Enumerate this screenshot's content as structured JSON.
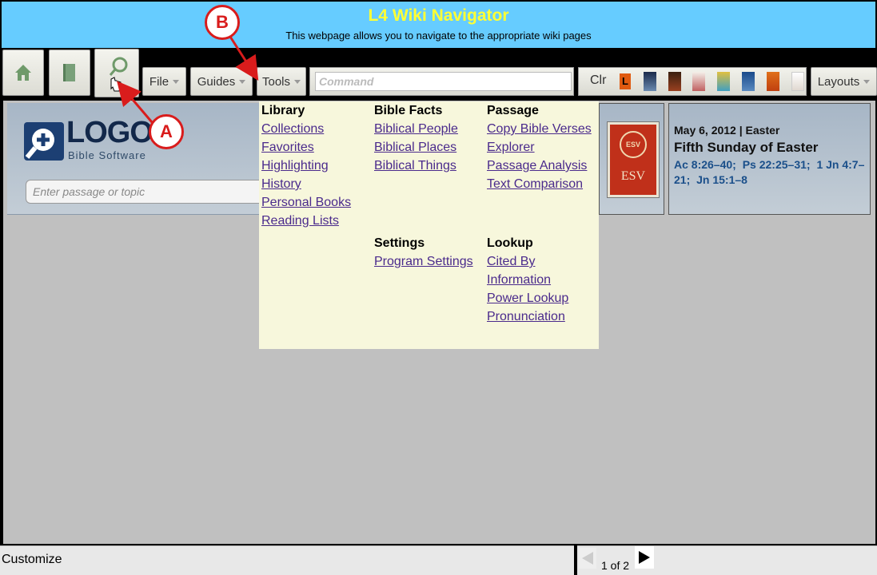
{
  "header": {
    "title": "L4 Wiki Navigator",
    "subtitle": "This webpage allows you to navigate to the appropriate wiki pages"
  },
  "toolbar": {
    "icons": [
      "home-icon",
      "library-book-icon",
      "search-icon"
    ],
    "menus": {
      "file": "File",
      "guides": "Guides",
      "tools": "Tools",
      "layouts": "Layouts"
    },
    "command_placeholder": "Command",
    "clr_label": "Clr",
    "resource_l_label": "L"
  },
  "home_panel": {
    "logo_text": "LOGOS",
    "logo_subtitle": "Bible Software",
    "passage_placeholder": "Enter passage or topic",
    "esv_label": "ESV",
    "esv_seal": "ESV",
    "lectionary": {
      "date": "May 6, 2012 | Easter",
      "title": "Fifth Sunday of Easter",
      "readings": [
        "Ac 8:26–40;",
        "Ps 22:25–31;",
        "1 Jn 4:7–21;",
        "Jn 15:1–8"
      ]
    }
  },
  "tools_menu": {
    "library": {
      "heading": "Library",
      "items": [
        "Collections",
        "Favorites",
        "Highlighting",
        "History",
        "Personal Books",
        "Reading Lists"
      ]
    },
    "bible_facts": {
      "heading": "Bible Facts",
      "items": [
        "Biblical People",
        "Biblical Places",
        "Biblical Things"
      ]
    },
    "passage": {
      "heading": "Passage",
      "items": [
        "Copy Bible Verses",
        "Explorer",
        "Passage Analysis",
        "Text Comparison"
      ]
    },
    "settings": {
      "heading": "Settings",
      "items": [
        "Program Settings"
      ]
    },
    "lookup": {
      "heading": "Lookup",
      "items": [
        "Cited By",
        "Information",
        "Power Lookup",
        "Pronunciation"
      ]
    }
  },
  "statusbar": {
    "customize": "Customize",
    "page_count": "1 of 2"
  },
  "callouts": {
    "a": "A",
    "b": "B"
  },
  "colors": {
    "header_bg": "#66ccff",
    "header_title": "#ffff33",
    "menu_bg": "#f7f7dc",
    "link": "#4a2a8c",
    "callout": "#d91c1c"
  }
}
